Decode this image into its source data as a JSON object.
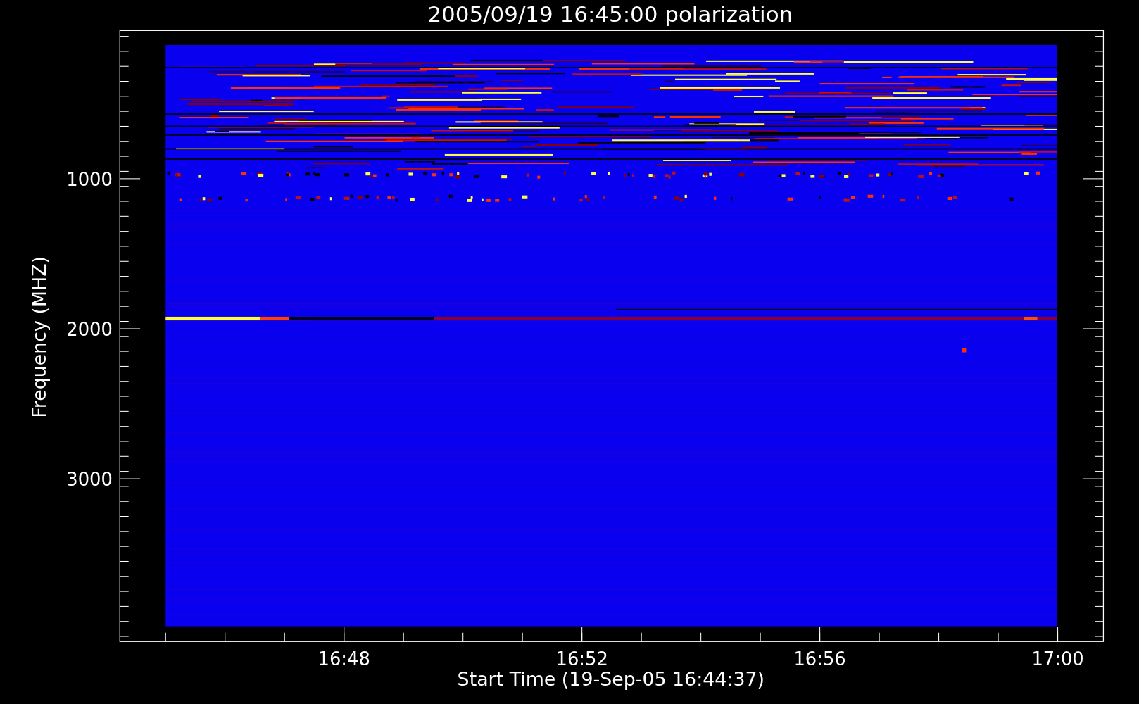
{
  "title": "2005/09/19 16:45:00 polarization",
  "y_axis": {
    "label": "Frequency (MHZ)",
    "ticks": [
      "1000",
      "2000",
      "3000"
    ]
  },
  "x_axis": {
    "label": "Start Time (19-Sep-05 16:44:37)",
    "ticks": [
      "16:48",
      "16:52",
      "16:56",
      "17:00"
    ]
  }
}
